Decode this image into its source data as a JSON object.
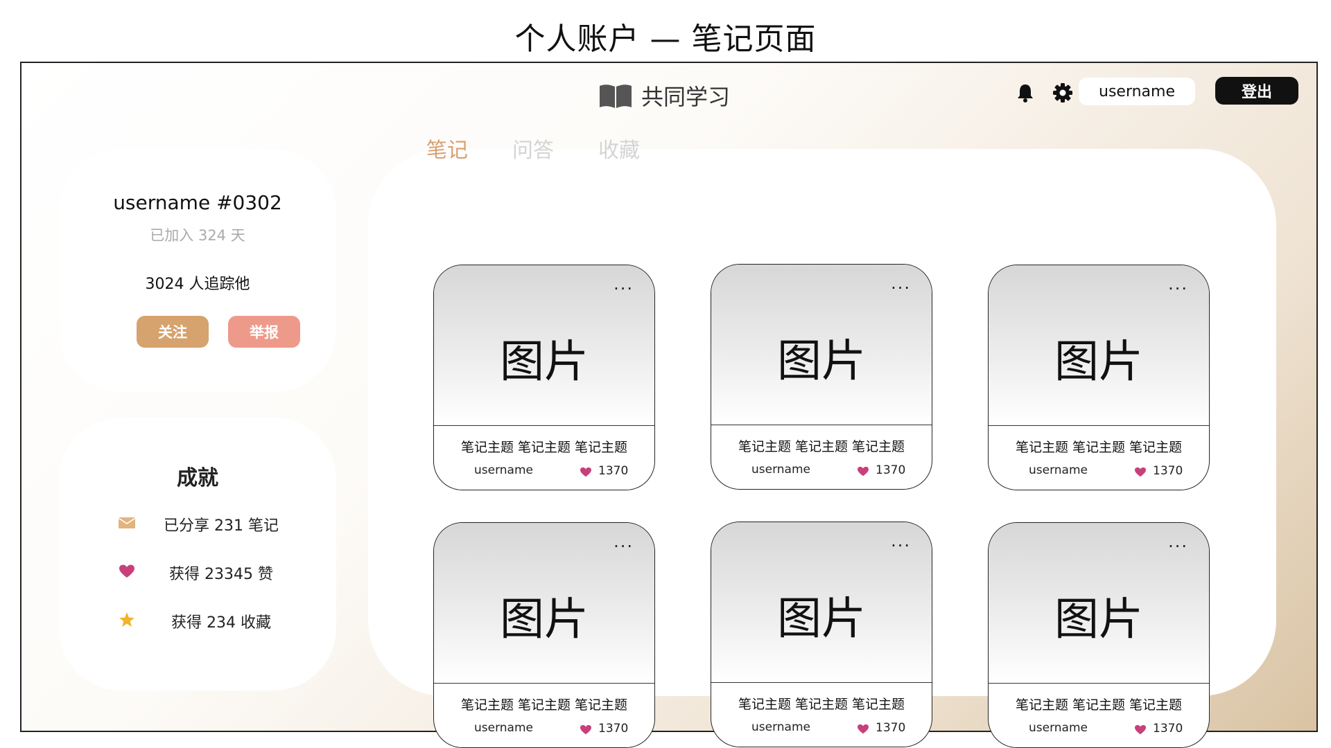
{
  "page_title": "个人账户 — 笔记页面",
  "header": {
    "brand_icon": "open-book-icon",
    "brand_name": "共同学习",
    "bell_icon": "bell-icon",
    "gear_icon": "gear-icon",
    "username": "username",
    "logout_label": "登出"
  },
  "profile": {
    "name": "username #0302",
    "joined": "已加入 324 天",
    "followers": "3024 人追踪他",
    "follow_label": "关注",
    "report_label": "举报"
  },
  "achievements": {
    "title": "成就",
    "items": [
      {
        "icon": "envelope-icon",
        "text": "已分享 231 笔记",
        "color": "#e2b47e"
      },
      {
        "icon": "heart-icon",
        "text": "获得 23345 赞",
        "color": "#c8407a"
      },
      {
        "icon": "star-icon",
        "text": "获得 234 收藏",
        "color": "#f0b429"
      }
    ]
  },
  "tabs": [
    {
      "label": "笔记",
      "active": true
    },
    {
      "label": "问答",
      "active": false
    },
    {
      "label": "收藏",
      "active": false
    }
  ],
  "notes": [
    {
      "image_label": "图片",
      "title": "笔记主题 笔记主题 笔记主题",
      "user": "username",
      "likes": "1370",
      "menu": "···"
    },
    {
      "image_label": "图片",
      "title": "笔记主题 笔记主题 笔记主题",
      "user": "username",
      "likes": "1370",
      "menu": "···"
    },
    {
      "image_label": "图片",
      "title": "笔记主题 笔记主题 笔记主题",
      "user": "username",
      "likes": "1370",
      "menu": "···"
    },
    {
      "image_label": "图片",
      "title": "笔记主题 笔记主题 笔记主题",
      "user": "username",
      "likes": "1370",
      "menu": "···"
    },
    {
      "image_label": "图片",
      "title": "笔记主题 笔记主题 笔记主题",
      "user": "username",
      "likes": "1370",
      "menu": "···"
    },
    {
      "image_label": "图片",
      "title": "笔记主题 笔记主题 笔记主题",
      "user": "username",
      "likes": "1370",
      "menu": "···"
    }
  ],
  "colors": {
    "accent": "#d8a070",
    "follow": "#d6a26d",
    "report": "#ee9a8a",
    "heart": "#c8407a",
    "logout_bg": "#111111"
  }
}
